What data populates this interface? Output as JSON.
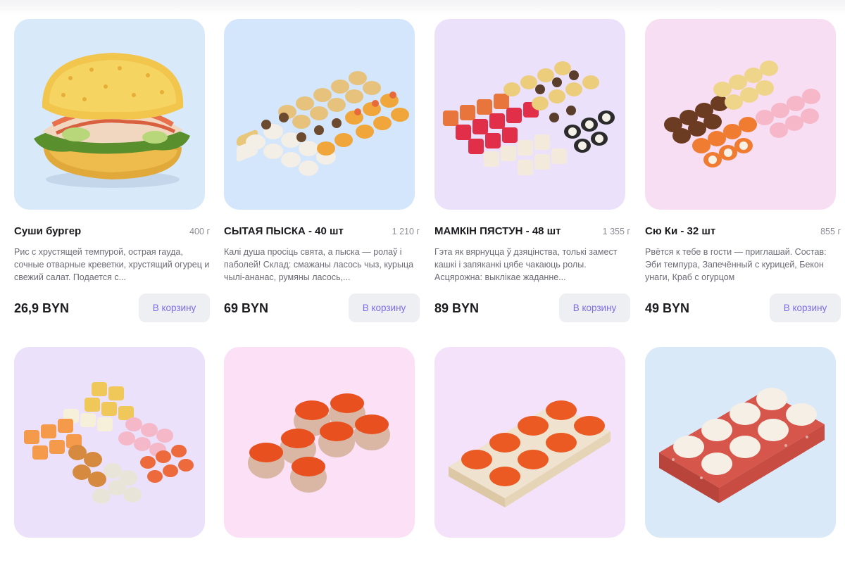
{
  "products": [
    {
      "title": "Суши бургер",
      "weight": "400 г",
      "description": "Рис с хрустящей темпурой, острая гауда, сочные отварные креветки, хрустящий огурец и свежий салат. Подается с...",
      "price": "26,9 BYN",
      "button_label": "В корзину",
      "bg_color": "#d8e9fa"
    },
    {
      "title": "СЫТАЯ ПЫСКА - 40 шт",
      "weight": "1 210 г",
      "description": "Калі душа просіць свята, а пыска — ролаў і паболей! Склад: смажаны ласось чыз, курыца чылі-ананас, румяны ласось,...",
      "price": "69 BYN",
      "button_label": "В корзину",
      "bg_color": "#d4e6fb"
    },
    {
      "title": "МАМКІН ПЯСТУН - 48 шт",
      "weight": "1 355 г",
      "description": "Гэта як вярнуцца ў дзяцінства, толькі замест кашкі і запяканкі цябе чакаюць ролы. Асцярожна: выклікае жаданне...",
      "price": "89 BYN",
      "button_label": "В корзину",
      "bg_color": "#ece1fb"
    },
    {
      "title": "Сю Ки - 32 шт",
      "weight": "855 г",
      "description": "Рвётся к тебе в гости — приглашай. Состав: Эби темпура, Запечённый с курицей, Бекон унаги, Краб с огурцом",
      "price": "49 BYN",
      "button_label": "В корзину",
      "bg_color": "#f7def3"
    },
    {
      "bg_color": "#ebe1fb"
    },
    {
      "bg_color": "#fce1f6"
    },
    {
      "bg_color": "#f4e2fb"
    },
    {
      "bg_color": "#d9e9f8"
    }
  ]
}
